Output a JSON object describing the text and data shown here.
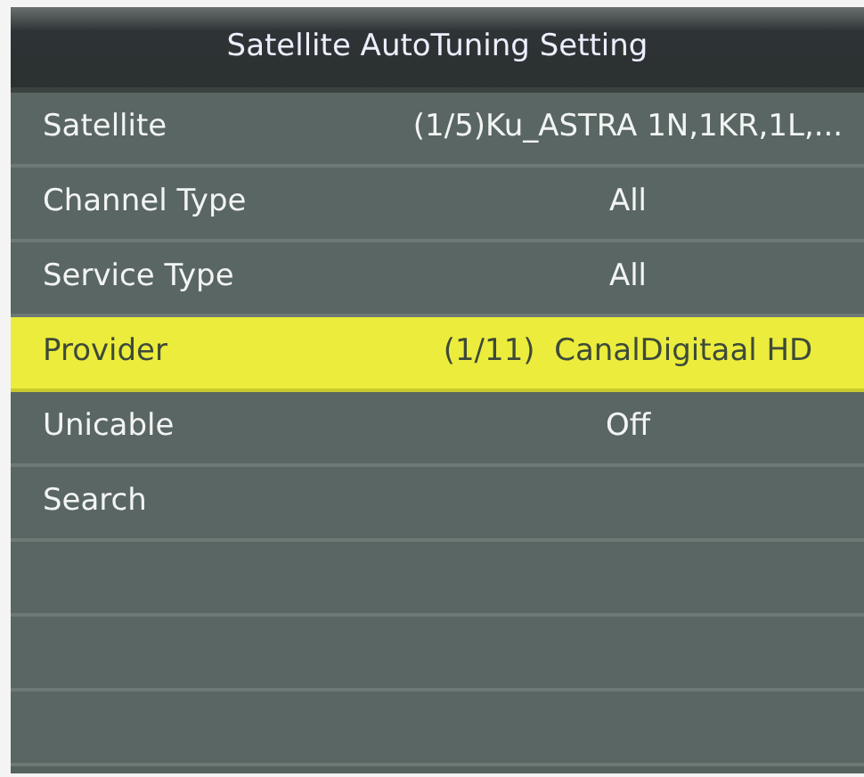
{
  "window": {
    "title": "Satellite AutoTuning Setting"
  },
  "items": [
    {
      "label": "Satellite",
      "value": "(1/5)Ku_ASTRA 1N,1KR,1L,...",
      "selected": false
    },
    {
      "label": "Channel Type",
      "value": "All",
      "selected": false
    },
    {
      "label": "Service Type",
      "value": "All",
      "selected": false
    },
    {
      "label": "Provider",
      "value": "(1/11)  CanalDigitaal HD",
      "selected": true
    },
    {
      "label": "Unicable",
      "value": "Off",
      "selected": false
    },
    {
      "label": "Search",
      "selected": false
    }
  ]
}
